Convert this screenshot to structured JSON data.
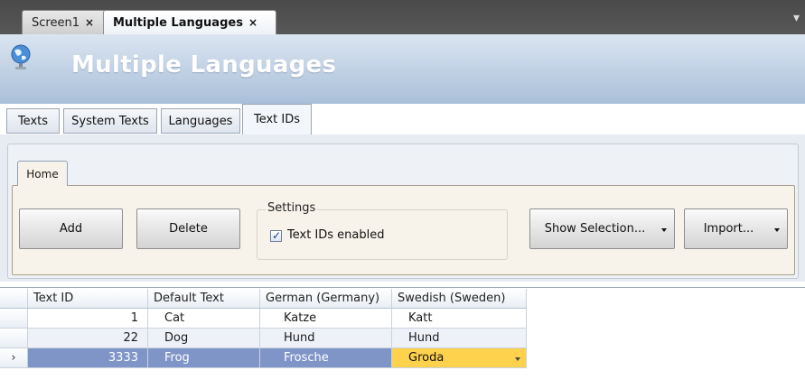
{
  "doc_tabs": [
    {
      "label": "Screen1",
      "close": "×"
    },
    {
      "label": "Multiple Languages",
      "close": "×"
    }
  ],
  "banner": {
    "title": "Multiple Languages",
    "icon": "globe-icon"
  },
  "section_tabs": [
    "Texts",
    "System Texts",
    "Languages",
    "Text IDs"
  ],
  "ribbon": {
    "home_tab": "Home",
    "add_label": "Add",
    "delete_label": "Delete",
    "settings_title": "Settings",
    "text_ids_enabled_label": "Text IDs enabled",
    "text_ids_enabled": true,
    "show_selection_label": "Show Selection...",
    "import_label": "Import..."
  },
  "grid": {
    "columns": [
      "Text ID",
      "Default Text",
      "German (Germany)",
      "Swedish (Sweden)"
    ],
    "rows": [
      {
        "id": "1",
        "default": "Cat",
        "german": "Katze",
        "swedish": "Katt"
      },
      {
        "id": "22",
        "default": "Dog",
        "german": "Hund",
        "swedish": "Hund"
      },
      {
        "id": "3333",
        "default": "Frog",
        "german": "Frosche",
        "swedish": "Groda"
      }
    ],
    "selected_row_marker": "›"
  },
  "colors": {
    "selection": "#7f95c8",
    "current_cell": "#ffd24d",
    "banner_top": "#dbe5f1",
    "banner_bottom": "#a9bfd9"
  }
}
